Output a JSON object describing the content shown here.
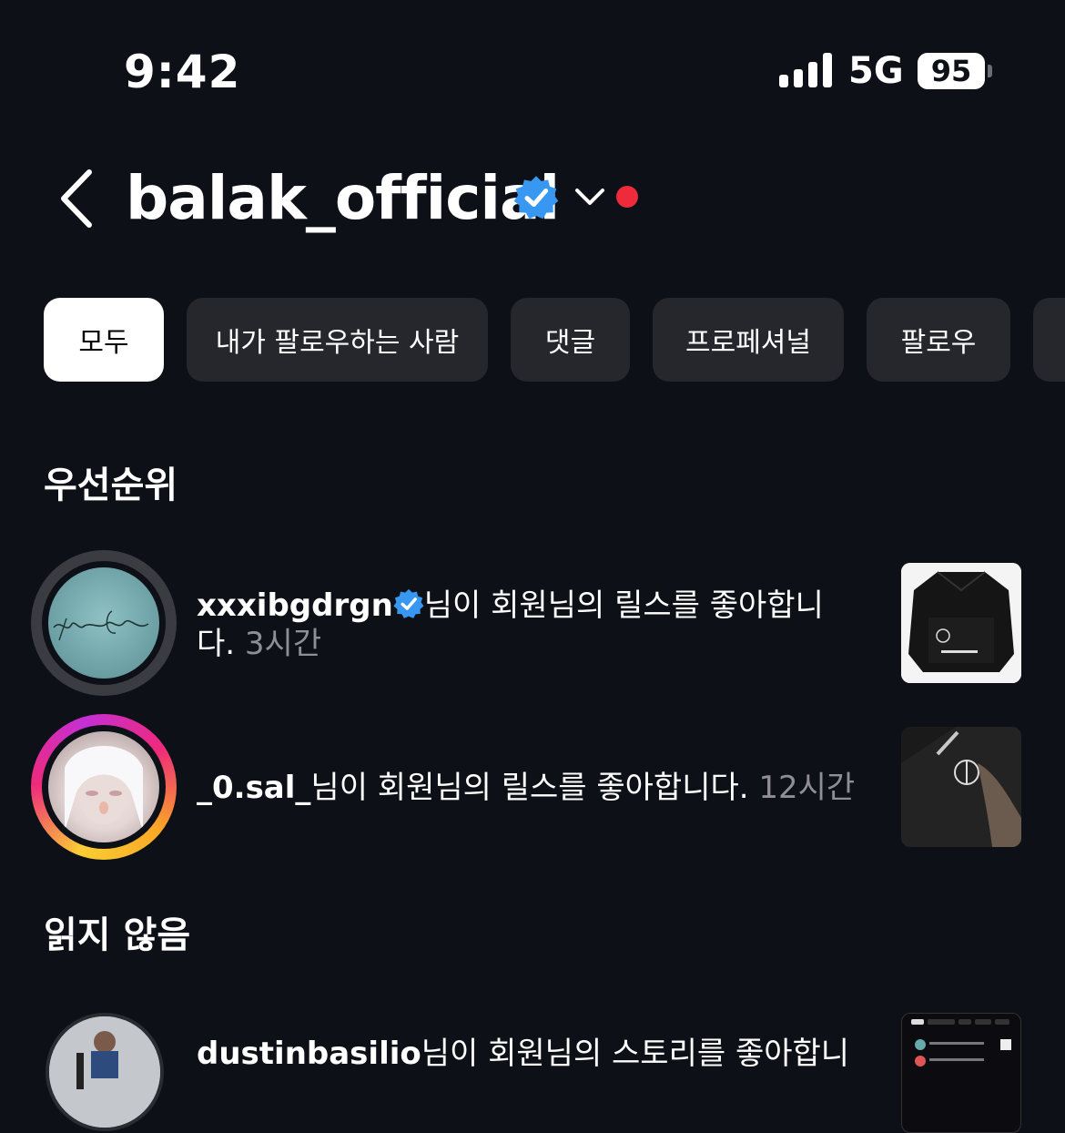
{
  "status_bar": {
    "time": "9:42",
    "network": "5G",
    "battery": "95"
  },
  "header": {
    "username": "balak_official"
  },
  "filters": [
    {
      "label": "모두"
    },
    {
      "label": "내가 팔로우하는 사람"
    },
    {
      "label": "댓글"
    },
    {
      "label": "프로페셔널"
    },
    {
      "label": "팔로우"
    }
  ],
  "sections": {
    "priority": "우선순위",
    "unread": "읽지 않음"
  },
  "notifications": [
    {
      "user": "xxxibgdrgn",
      "verified": true,
      "message_line1": "님이 회원님의 릴스를 좋아합니",
      "message_line2": "다.",
      "time": "3시간",
      "avatar_signature": "Mmmur G-Dragon"
    },
    {
      "user": "_0.sal_",
      "verified": false,
      "message": "님이 회원님의 릴스를 좋아합니다.",
      "time": "12시간"
    },
    {
      "user": "dustinbasilio",
      "verified": false,
      "message": "님이 회원님의 스토리를 좋아합니"
    }
  ]
}
